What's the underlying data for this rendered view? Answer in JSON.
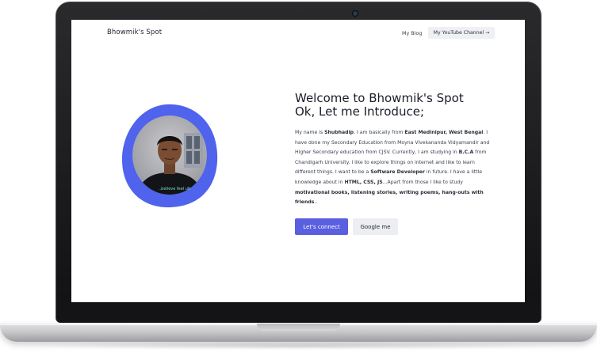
{
  "site": {
    "brand": "Bhowmik's Spot"
  },
  "nav": {
    "blog_label": "My Blog",
    "youtube_label": "My YouTube Channel",
    "youtube_arrow": "→"
  },
  "hero": {
    "title_line1": "Welcome to Bhowmik's Spot",
    "title_line2": "Ok, Let me Introduce;",
    "bio": [
      {
        "t": "My name is "
      },
      {
        "t": "Shubhadip",
        "b": true
      },
      {
        "t": ". I am basically from "
      },
      {
        "t": "East Medinipur, West Bengal",
        "b": true
      },
      {
        "t": ". I have done my Secondary Education from Moyna Vivekananda Vidyamandir and Higher Secondary education from CJSV. Currently, I am studying in "
      },
      {
        "t": "B.C.A",
        "b": true
      },
      {
        "t": " from Chandigarh University. I like to explore things on internet and like to learn different things. I want to be a "
      },
      {
        "t": "Software Developer",
        "b": true
      },
      {
        "t": " in future. I have a little knowledge about in "
      },
      {
        "t": "HTML, CSS, JS",
        "b": true
      },
      {
        "t": "...Apart from those I like to study "
      },
      {
        "t": "motivational books, listening stories, writing poems, hang-outs with friends",
        "b": true
      },
      {
        "t": ".."
      }
    ],
    "connect_label": "Let's connect",
    "google_label": "Google me",
    "shirt_text": "..believe feel ult"
  },
  "colors": {
    "accent": "#5a5fe0",
    "blob": "#4f63ec"
  }
}
